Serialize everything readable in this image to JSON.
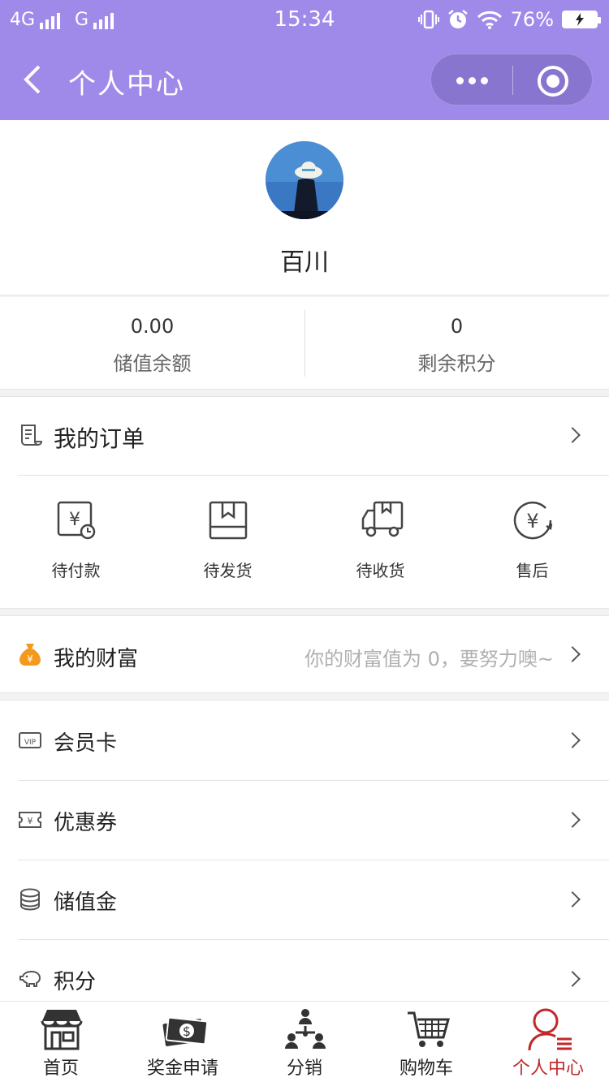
{
  "status_bar": {
    "network_left": "4G",
    "network_right": "G",
    "time": "15:34",
    "battery": "76%"
  },
  "nav": {
    "title": "个人中心"
  },
  "profile": {
    "name": "百川"
  },
  "stats": [
    {
      "value": "0.00",
      "label": "储值余额"
    },
    {
      "value": "0",
      "label": "剩余积分"
    }
  ],
  "orders": {
    "title": "我的订单",
    "items": [
      {
        "label": "待付款",
        "icon": "payment-pending-icon"
      },
      {
        "label": "待发货",
        "icon": "box-icon"
      },
      {
        "label": "待收货",
        "icon": "truck-icon"
      },
      {
        "label": "售后",
        "icon": "yen-refund-icon"
      }
    ]
  },
  "wealth": {
    "title": "我的财富",
    "hint": "你的财富值为 0，要努力噢~",
    "icon": "money-bag-icon"
  },
  "menu": [
    {
      "label": "会员卡",
      "icon": "vip-card-icon"
    },
    {
      "label": "优惠券",
      "icon": "coupon-icon"
    },
    {
      "label": "储值金",
      "icon": "coin-stack-icon"
    },
    {
      "label": "积分",
      "icon": "piggy-bank-icon"
    }
  ],
  "tabs": [
    {
      "label": "首页",
      "icon": "store-icon"
    },
    {
      "label": "奖金申请",
      "icon": "cash-icon"
    },
    {
      "label": "分销",
      "icon": "network-people-icon"
    },
    {
      "label": "购物车",
      "icon": "cart-icon"
    },
    {
      "label": "个人中心",
      "icon": "user-icon"
    }
  ],
  "colors": {
    "header": "#9f8ae9",
    "active_tab": "#c0282a",
    "wealth_icon": "#f39a1e"
  }
}
